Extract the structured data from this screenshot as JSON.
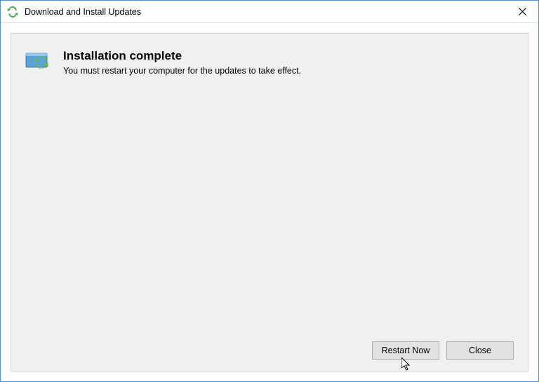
{
  "window": {
    "title": "Download and Install Updates"
  },
  "content": {
    "heading": "Installation complete",
    "message": "You must restart your computer for the updates to take effect."
  },
  "buttons": {
    "restart_label": "Restart Now",
    "close_label": "Close"
  }
}
